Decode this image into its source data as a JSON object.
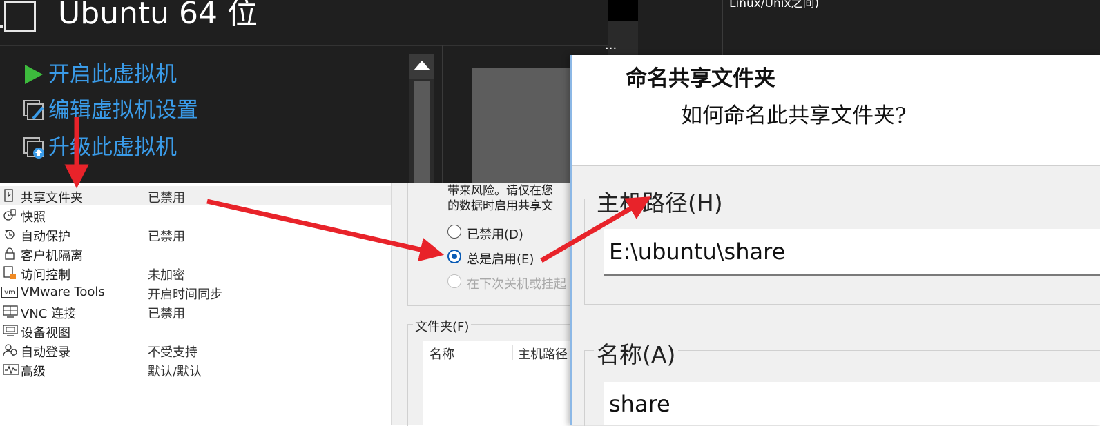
{
  "vm_header": {
    "title": "Ubuntu 64 位",
    "actions": [
      {
        "label": "开启此虚拟机",
        "icon": "play-icon"
      },
      {
        "label": "编辑虚拟机设置",
        "icon": "edit-settings-icon"
      },
      {
        "label": "升级此虚拟机",
        "icon": "upgrade-icon"
      }
    ],
    "overflow_text": "...",
    "top_right_text": "Linux/Unix之间)"
  },
  "settings_list": [
    {
      "name": "共享文件夹",
      "value": "已禁用",
      "icon": "shared-folder-icon",
      "selected": true
    },
    {
      "name": "快照",
      "value": "",
      "icon": "snapshot-icon"
    },
    {
      "name": "自动保护",
      "value": "已禁用",
      "icon": "auto-protect-icon"
    },
    {
      "name": "客户机隔离",
      "value": "",
      "icon": "lock-icon"
    },
    {
      "name": "访问控制",
      "value": "未加密",
      "icon": "access-control-icon"
    },
    {
      "name": "VMware Tools",
      "value": "开启时间同步",
      "icon": "vm-icon"
    },
    {
      "name": "VNC 连接",
      "value": "已禁用",
      "icon": "vnc-icon"
    },
    {
      "name": "设备视图",
      "value": "",
      "icon": "device-view-icon"
    },
    {
      "name": "自动登录",
      "value": "不受支持",
      "icon": "auto-login-icon"
    },
    {
      "name": "高级",
      "value": "默认/默认",
      "icon": "advanced-icon"
    }
  ],
  "shared_folders_panel": {
    "risk_text": "带来风险。请仅在您的数据时启用共享文",
    "risk_line1": "带来风险。请仅在您",
    "risk_line2": "的数据时启用共享文",
    "options": [
      {
        "label": "已禁用(D)",
        "state": "off"
      },
      {
        "label": "总是启用(E)",
        "state": "on"
      },
      {
        "label": "在下次关机或挂起",
        "state": "disabled"
      }
    ],
    "folders_legend": "文件夹(F)",
    "columns": [
      "名称",
      "主机路径"
    ]
  },
  "wizard": {
    "title": "命名共享文件夹",
    "subtitle": "如何命名此共享文件夹?",
    "host_path_label": "主机路径(H)",
    "host_path_value": "E:\\ubuntu\\share",
    "name_label": "名称(A)",
    "name_value": "share"
  },
  "colors": {
    "dark_bg": "#1f1f1f",
    "link_blue": "#3a9be8",
    "play_green": "#3dbb3d",
    "arrow_red": "#e8232a",
    "radio_blue": "#0a5bb5"
  }
}
